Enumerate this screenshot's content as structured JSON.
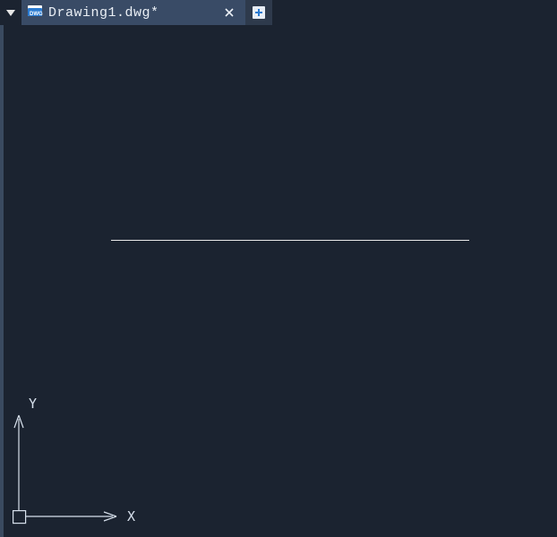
{
  "tabs": {
    "active": {
      "label": "Drawing1.dwg*",
      "icon": "dwg-file-icon"
    }
  },
  "ucs": {
    "x_label": "X",
    "y_label": "Y"
  }
}
